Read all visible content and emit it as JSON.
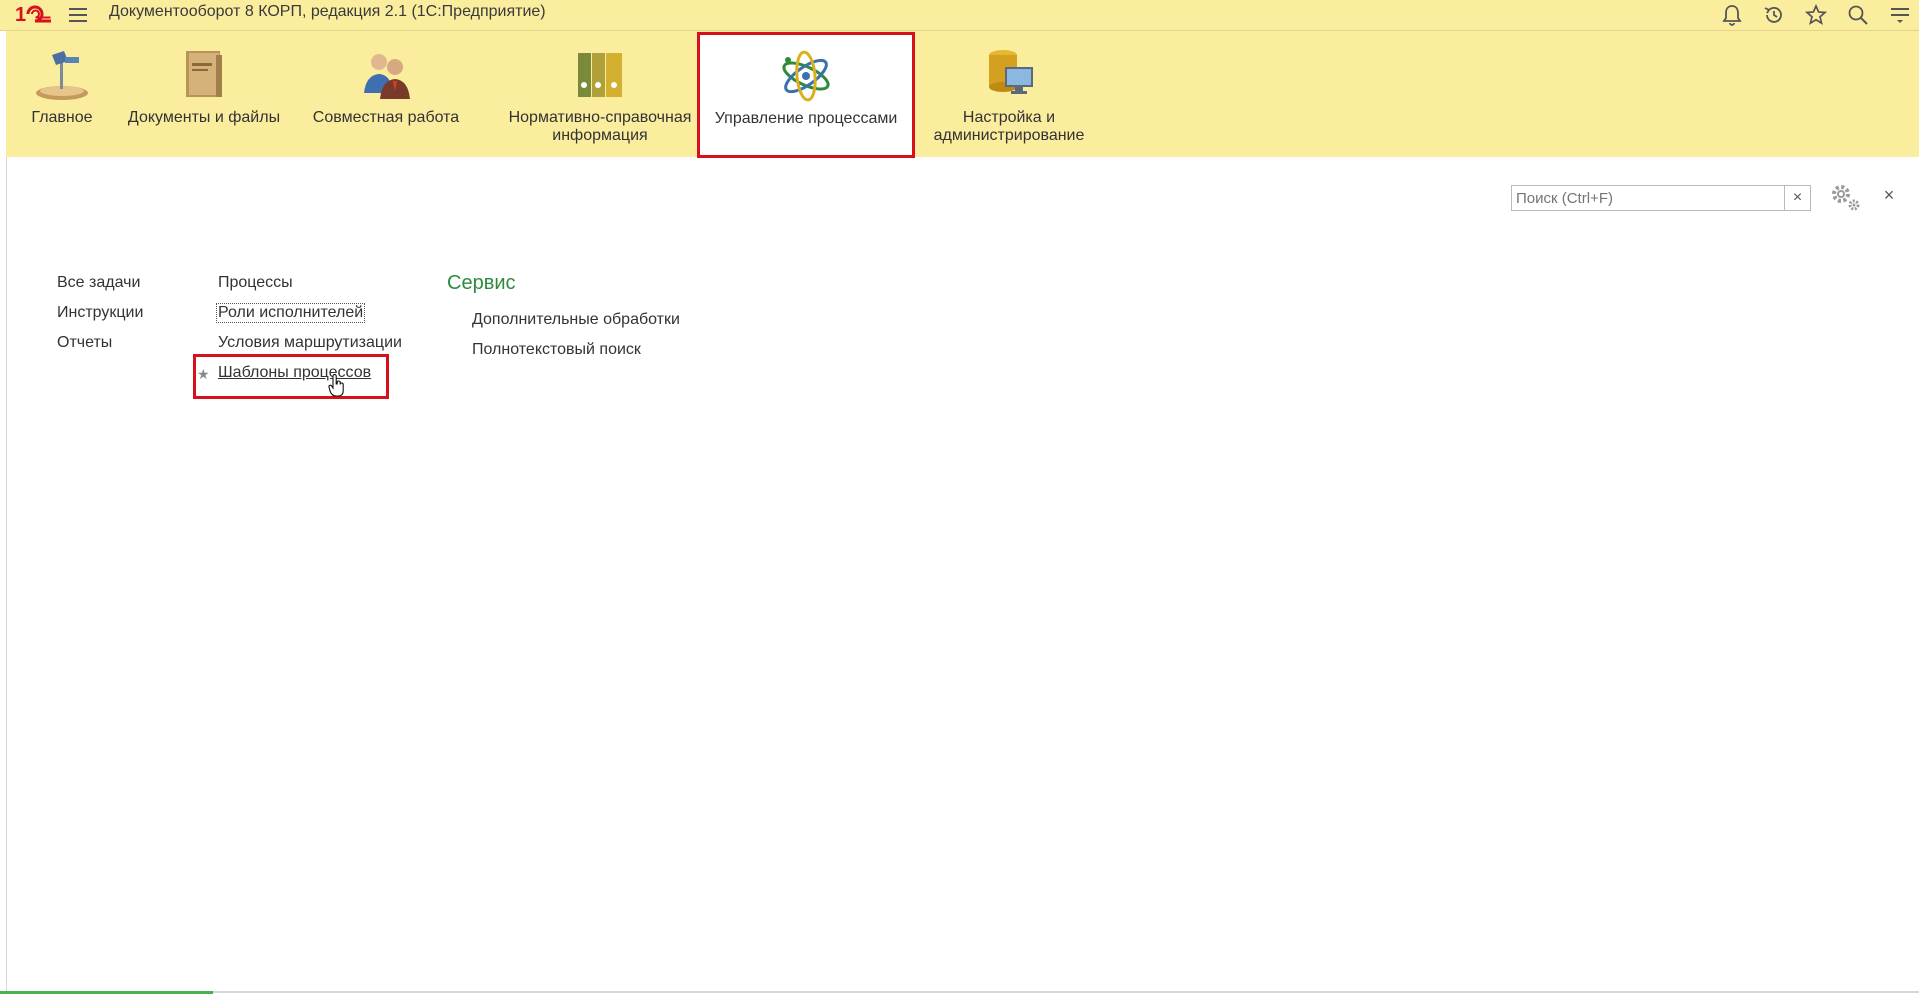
{
  "titlebar": {
    "app_title": "Документооборот 8 КОРП, редакция 2.1  (1С:Предприятие)",
    "logo_text": "1С"
  },
  "sections": [
    {
      "label": "Главное",
      "icon": "desk-lamp-icon"
    },
    {
      "label": "Документы и файлы",
      "icon": "document-box-icon"
    },
    {
      "label": "Совместная работа",
      "icon": "people-icon"
    },
    {
      "label": "Нормативно-справочная\nинформация",
      "icon": "binders-icon"
    },
    {
      "label": "Управление процессами",
      "icon": "atom-icon",
      "active": true
    },
    {
      "label": "Настройка и\nадминистрирование",
      "icon": "database-computer-icon"
    }
  ],
  "search": {
    "placeholder": "Поиск (Ctrl+F)"
  },
  "commands": {
    "col1": [
      "Все задачи",
      "Инструкции",
      "Отчеты"
    ],
    "col2": [
      "Процессы",
      "Роли исполнителей",
      "Условия маршрутизации",
      "Шаблоны процессов"
    ],
    "service_title": "Сервис",
    "service": [
      "Дополнительные обработки",
      "Полнотекстовый поиск"
    ]
  },
  "colors": {
    "panel_bg": "#fbed9e",
    "highlight_red": "#d8101b",
    "group_title_green": "#2f8a3e"
  }
}
